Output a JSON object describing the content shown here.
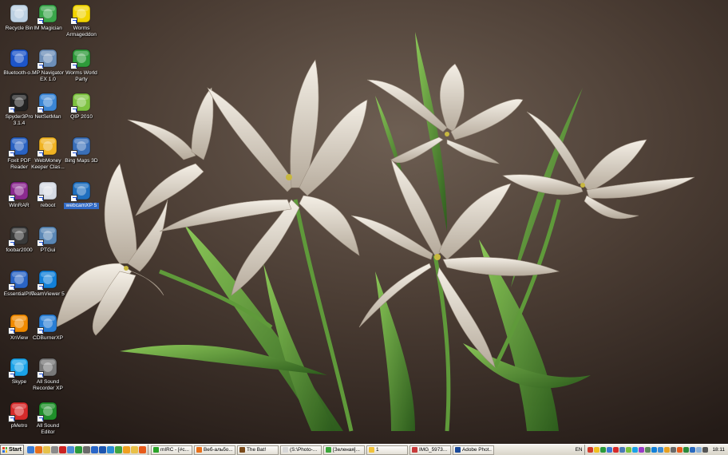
{
  "desktop_icons": [
    {
      "id": "recycle-bin",
      "label": "Recycle Bin",
      "icon": "recycle-bin-icon",
      "color": "#bcd0e2",
      "col": 0,
      "row": 0,
      "shortcut": false
    },
    {
      "id": "im-magician",
      "label": "IM Magician",
      "icon": "person-icon",
      "color": "#3aa64a",
      "col": 1,
      "row": 0,
      "shortcut": true
    },
    {
      "id": "worms-armageddon",
      "label": "Worms Armageddon",
      "icon": "radiation-icon",
      "color": "#f2d400",
      "col": 2,
      "row": 0,
      "shortcut": true
    },
    {
      "id": "bluetooth",
      "label": "Bluetooth-o...",
      "icon": "bluetooth-icon",
      "color": "#1d55c9",
      "col": 0,
      "row": 1,
      "shortcut": false
    },
    {
      "id": "mp-navigator",
      "label": "MP Navigator EX 1.0",
      "icon": "scanner-icon",
      "color": "#6d8fb9",
      "col": 1,
      "row": 1,
      "shortcut": true
    },
    {
      "id": "worms-world-party",
      "label": "Worms World Party",
      "icon": "globe-icon",
      "color": "#2e9a3a",
      "col": 2,
      "row": 1,
      "shortcut": true
    },
    {
      "id": "spyder3pro",
      "label": "Spyder3Pro 3.1.4",
      "icon": "spyder-icon",
      "color": "#222222",
      "col": 0,
      "row": 2,
      "shortcut": true
    },
    {
      "id": "netsetman",
      "label": "NetSetMan",
      "icon": "monitor-icon",
      "color": "#3b86d6",
      "col": 1,
      "row": 2,
      "shortcut": true
    },
    {
      "id": "qip-2010",
      "label": "QIP 2010",
      "icon": "flower-icon",
      "color": "#7dc23f",
      "col": 2,
      "row": 2,
      "shortcut": true
    },
    {
      "id": "foxit-pdf",
      "label": "Foxit PDF Reader",
      "icon": "pdf-icon",
      "color": "#2a62c2",
      "col": 0,
      "row": 3,
      "shortcut": true
    },
    {
      "id": "webmoney",
      "label": "WebMoney Keeper Clas...",
      "icon": "webmoney-icon",
      "color": "#f0b323",
      "col": 1,
      "row": 3,
      "shortcut": true
    },
    {
      "id": "bing-maps",
      "label": "Bing Maps 3D",
      "icon": "globe-icon",
      "color": "#3a6fb8",
      "col": 2,
      "row": 3,
      "shortcut": true
    },
    {
      "id": "winrar",
      "label": "WinRAR",
      "icon": "archive-icon",
      "color": "#8b2a8f",
      "col": 0,
      "row": 4,
      "shortcut": true
    },
    {
      "id": "reboot",
      "label": "reboot",
      "icon": "settings-icon",
      "color": "#d6dbe4",
      "col": 1,
      "row": 4,
      "shortcut": true
    },
    {
      "id": "webcamxp",
      "label": "webcamXP 5",
      "icon": "webcam-icon",
      "color": "#1f6fbf",
      "col": 2,
      "row": 4,
      "shortcut": true,
      "selected": true
    },
    {
      "id": "foobar2000",
      "label": "foobar2000",
      "icon": "alien-icon",
      "color": "#3a3a3a",
      "col": 0,
      "row": 5,
      "shortcut": true
    },
    {
      "id": "ptgui",
      "label": "PTGui",
      "icon": "panorama-icon",
      "color": "#5a87b5",
      "col": 1,
      "row": 5,
      "shortcut": true
    },
    {
      "id": "essentialpim",
      "label": "EssentialPIM",
      "icon": "pim-icon",
      "color": "#2a64c4",
      "col": 0,
      "row": 6,
      "shortcut": true
    },
    {
      "id": "teamviewer",
      "label": "TeamViewer 5",
      "icon": "teamviewer-icon",
      "color": "#1280d9",
      "col": 1,
      "row": 6,
      "shortcut": true
    },
    {
      "id": "xnview",
      "label": "XnView",
      "icon": "xnview-icon",
      "color": "#f08a00",
      "col": 0,
      "row": 7,
      "shortcut": true
    },
    {
      "id": "cdburnerxp",
      "label": "CDBurnerXP",
      "icon": "disc-icon",
      "color": "#2a7fd6",
      "col": 1,
      "row": 7,
      "shortcut": true
    },
    {
      "id": "skype",
      "label": "Skype",
      "icon": "skype-icon",
      "color": "#1aa3e8",
      "col": 0,
      "row": 8,
      "shortcut": true
    },
    {
      "id": "all-sound-recorder",
      "label": "All Sound Recorder XP",
      "icon": "speaker-icon",
      "color": "#7a7a7a",
      "col": 1,
      "row": 8,
      "shortcut": true
    },
    {
      "id": "pmetro",
      "label": "pMetro",
      "icon": "metro-icon",
      "color": "#d62a2a",
      "col": 0,
      "row": 9,
      "shortcut": true
    },
    {
      "id": "all-sound-editor",
      "label": "All Sound Editor",
      "icon": "waveform-icon",
      "color": "#1f8f2a",
      "col": 1,
      "row": 9,
      "shortcut": true
    }
  ],
  "taskbar": {
    "start_label": "Start",
    "quick_launch": [
      {
        "name": "show-desktop-icon",
        "color": "#3a7bd5"
      },
      {
        "name": "firefox-icon",
        "color": "#e8701a"
      },
      {
        "name": "explorer-icon",
        "color": "#e6c24a"
      },
      {
        "name": "search-icon",
        "color": "#8a8a8a"
      },
      {
        "name": "opera-icon",
        "color": "#cc2222"
      },
      {
        "name": "link-icon",
        "color": "#4b8bd6"
      },
      {
        "name": "mail-icon",
        "color": "#2a9a3a"
      },
      {
        "name": "calc-icon",
        "color": "#6a6a6a"
      },
      {
        "name": "ie-icon",
        "color": "#2a66c8"
      },
      {
        "name": "word-icon",
        "color": "#1c55b0"
      },
      {
        "name": "globe-icon",
        "color": "#2b8ad6"
      },
      {
        "name": "network-icon",
        "color": "#3fa53f"
      },
      {
        "name": "paint-icon",
        "color": "#f0a020"
      },
      {
        "name": "folder-icon",
        "color": "#e8c048"
      },
      {
        "name": "orange-app-icon",
        "color": "#e85a1a"
      }
    ],
    "tasks": [
      {
        "label": "mIRC - [#c...",
        "color": "#2aa42a"
      },
      {
        "label": "Веб-альбо...",
        "color": "#e8701a"
      },
      {
        "label": "The Bat!",
        "color": "#7a4a1a"
      },
      {
        "label": "(S:\\Photo-...",
        "color": "#d8d8d8"
      },
      {
        "label": "[Зеленая]...",
        "color": "#3aa63a"
      },
      {
        "label": "1",
        "color": "#f2c33a"
      },
      {
        "label": "IMG_5973...",
        "color": "#c83a3a"
      },
      {
        "label": "Adobe Phot...",
        "color": "#1a4a9a"
      }
    ],
    "language": "EN",
    "tray": [
      {
        "name": "tray-b-icon",
        "color": "#d13a2a"
      },
      {
        "name": "tray-z-icon",
        "color": "#f0c020"
      },
      {
        "name": "tray-green-icon",
        "color": "#2a9a3a"
      },
      {
        "name": "tray-shield-icon",
        "color": "#3a78d6"
      },
      {
        "name": "tray-red-icon",
        "color": "#d62a2a"
      },
      {
        "name": "tray-monitor-icon",
        "color": "#4a7ab8"
      },
      {
        "name": "tray-leaf-icon",
        "color": "#7ac23a"
      },
      {
        "name": "tray-skype-icon",
        "color": "#1aa3e8"
      },
      {
        "name": "tray-music-icon",
        "color": "#9a3ac8"
      },
      {
        "name": "tray-network-icon",
        "color": "#5a8a5a"
      },
      {
        "name": "tray-teamviewer-icon",
        "color": "#1280d9"
      },
      {
        "name": "tray-globe-icon",
        "color": "#3a8ad6"
      },
      {
        "name": "tray-star-icon",
        "color": "#e8a020"
      },
      {
        "name": "tray-volume-icon",
        "color": "#6a6a6a"
      },
      {
        "name": "tray-fire-icon",
        "color": "#e85a1a"
      },
      {
        "name": "tray-shield-green-icon",
        "color": "#2a8a3a"
      },
      {
        "name": "tray-webcam-icon",
        "color": "#2a6ac0"
      },
      {
        "name": "tray-cloud-icon",
        "color": "#8ab0d8"
      },
      {
        "name": "tray-speaker-icon",
        "color": "#555555"
      }
    ],
    "clock": "18:11"
  }
}
